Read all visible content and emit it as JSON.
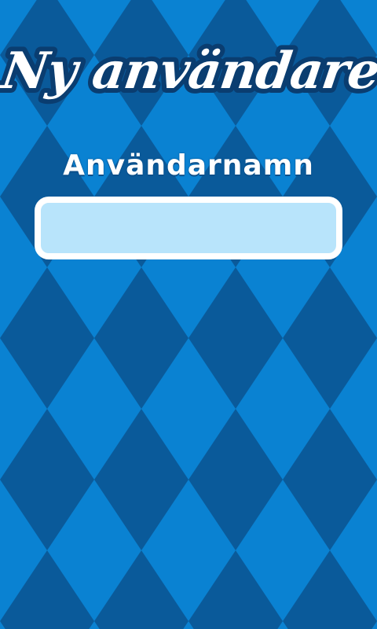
{
  "screen": {
    "title": "Ny användare"
  },
  "form": {
    "username_label": "Användarnamn",
    "username_value": "",
    "username_placeholder": ""
  },
  "theme": {
    "bg_light": "#0a82d2",
    "bg_dark": "#0a5a9a",
    "title_fill": "#ffffff",
    "title_outline": "#0a3d70",
    "input_fill": "#b8e4fb",
    "input_border": "#ffffff"
  }
}
